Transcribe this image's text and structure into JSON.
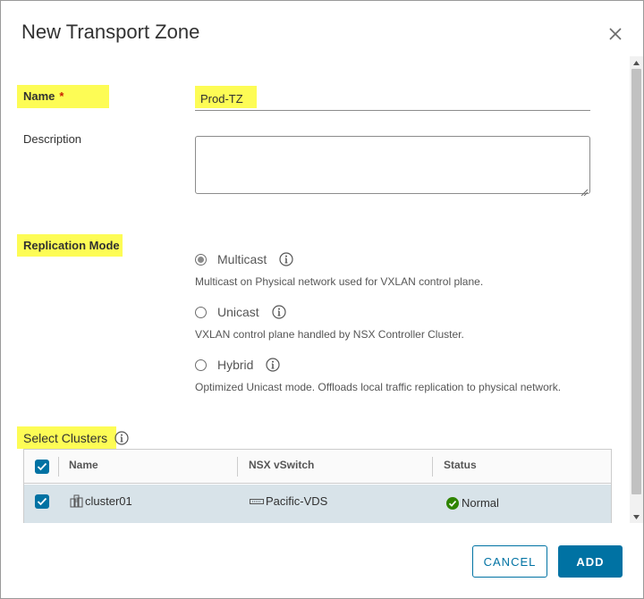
{
  "dialog": {
    "title": "New Transport Zone"
  },
  "form": {
    "name_label": "Name",
    "required_marker": "*",
    "name_value": "Prod-TZ",
    "description_label": "Description",
    "description_value": "",
    "replication_label": "Replication Mode",
    "replication_options": [
      {
        "label": "Multicast",
        "description": "Multicast on Physical network used for VXLAN control plane.",
        "selected": true
      },
      {
        "label": "Unicast",
        "description": "VXLAN control plane handled by NSX Controller Cluster.",
        "selected": false
      },
      {
        "label": "Hybrid",
        "description": "Optimized Unicast mode. Offloads local traffic replication to physical network.",
        "selected": false
      }
    ],
    "clusters_label": "Select Clusters"
  },
  "grid": {
    "columns": [
      "Name",
      "NSX vSwitch",
      "Status"
    ],
    "rows": [
      {
        "name": "cluster01",
        "vswitch": "Pacific-VDS",
        "status": "Normal",
        "selected": true
      }
    ]
  },
  "footer": {
    "cancel_label": "CANCEL",
    "add_label": "ADD"
  },
  "colors": {
    "accent": "#0072a3",
    "highlight": "#fdfc55",
    "selected_row": "#d8e3e9",
    "status_ok": "#2f8400",
    "required": "#c92100"
  },
  "icons": {
    "close": "close-icon",
    "info": "info-icon",
    "cluster": "cluster-icon",
    "vswitch": "vswitch-icon",
    "status": "check-circle-icon"
  }
}
